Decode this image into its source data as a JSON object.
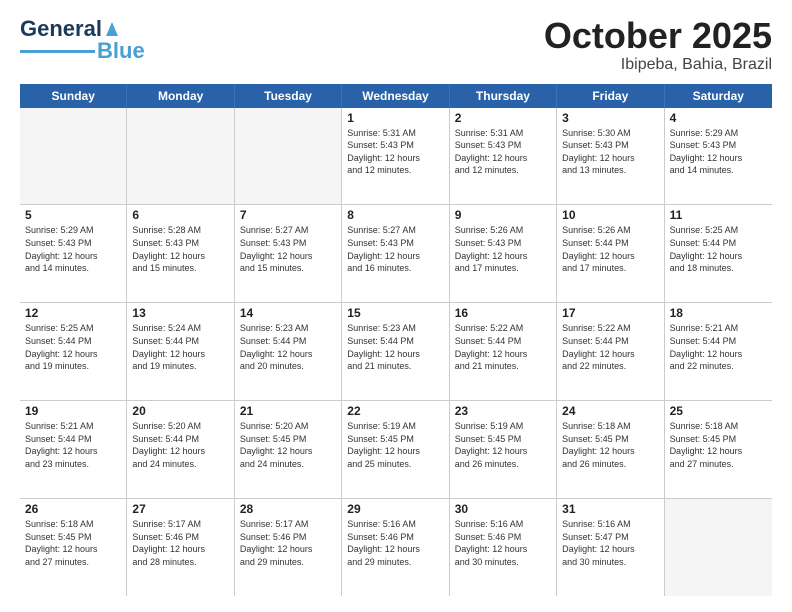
{
  "logo": {
    "text1": "General",
    "text2": "Blue"
  },
  "title": "October 2025",
  "location": "Ibipeba, Bahia, Brazil",
  "days": [
    "Sunday",
    "Monday",
    "Tuesday",
    "Wednesday",
    "Thursday",
    "Friday",
    "Saturday"
  ],
  "weeks": [
    [
      {
        "day": "",
        "info": ""
      },
      {
        "day": "",
        "info": ""
      },
      {
        "day": "",
        "info": ""
      },
      {
        "day": "1",
        "info": "Sunrise: 5:31 AM\nSunset: 5:43 PM\nDaylight: 12 hours\nand 12 minutes."
      },
      {
        "day": "2",
        "info": "Sunrise: 5:31 AM\nSunset: 5:43 PM\nDaylight: 12 hours\nand 12 minutes."
      },
      {
        "day": "3",
        "info": "Sunrise: 5:30 AM\nSunset: 5:43 PM\nDaylight: 12 hours\nand 13 minutes."
      },
      {
        "day": "4",
        "info": "Sunrise: 5:29 AM\nSunset: 5:43 PM\nDaylight: 12 hours\nand 14 minutes."
      }
    ],
    [
      {
        "day": "5",
        "info": "Sunrise: 5:29 AM\nSunset: 5:43 PM\nDaylight: 12 hours\nand 14 minutes."
      },
      {
        "day": "6",
        "info": "Sunrise: 5:28 AM\nSunset: 5:43 PM\nDaylight: 12 hours\nand 15 minutes."
      },
      {
        "day": "7",
        "info": "Sunrise: 5:27 AM\nSunset: 5:43 PM\nDaylight: 12 hours\nand 15 minutes."
      },
      {
        "day": "8",
        "info": "Sunrise: 5:27 AM\nSunset: 5:43 PM\nDaylight: 12 hours\nand 16 minutes."
      },
      {
        "day": "9",
        "info": "Sunrise: 5:26 AM\nSunset: 5:43 PM\nDaylight: 12 hours\nand 17 minutes."
      },
      {
        "day": "10",
        "info": "Sunrise: 5:26 AM\nSunset: 5:44 PM\nDaylight: 12 hours\nand 17 minutes."
      },
      {
        "day": "11",
        "info": "Sunrise: 5:25 AM\nSunset: 5:44 PM\nDaylight: 12 hours\nand 18 minutes."
      }
    ],
    [
      {
        "day": "12",
        "info": "Sunrise: 5:25 AM\nSunset: 5:44 PM\nDaylight: 12 hours\nand 19 minutes."
      },
      {
        "day": "13",
        "info": "Sunrise: 5:24 AM\nSunset: 5:44 PM\nDaylight: 12 hours\nand 19 minutes."
      },
      {
        "day": "14",
        "info": "Sunrise: 5:23 AM\nSunset: 5:44 PM\nDaylight: 12 hours\nand 20 minutes."
      },
      {
        "day": "15",
        "info": "Sunrise: 5:23 AM\nSunset: 5:44 PM\nDaylight: 12 hours\nand 21 minutes."
      },
      {
        "day": "16",
        "info": "Sunrise: 5:22 AM\nSunset: 5:44 PM\nDaylight: 12 hours\nand 21 minutes."
      },
      {
        "day": "17",
        "info": "Sunrise: 5:22 AM\nSunset: 5:44 PM\nDaylight: 12 hours\nand 22 minutes."
      },
      {
        "day": "18",
        "info": "Sunrise: 5:21 AM\nSunset: 5:44 PM\nDaylight: 12 hours\nand 22 minutes."
      }
    ],
    [
      {
        "day": "19",
        "info": "Sunrise: 5:21 AM\nSunset: 5:44 PM\nDaylight: 12 hours\nand 23 minutes."
      },
      {
        "day": "20",
        "info": "Sunrise: 5:20 AM\nSunset: 5:44 PM\nDaylight: 12 hours\nand 24 minutes."
      },
      {
        "day": "21",
        "info": "Sunrise: 5:20 AM\nSunset: 5:45 PM\nDaylight: 12 hours\nand 24 minutes."
      },
      {
        "day": "22",
        "info": "Sunrise: 5:19 AM\nSunset: 5:45 PM\nDaylight: 12 hours\nand 25 minutes."
      },
      {
        "day": "23",
        "info": "Sunrise: 5:19 AM\nSunset: 5:45 PM\nDaylight: 12 hours\nand 26 minutes."
      },
      {
        "day": "24",
        "info": "Sunrise: 5:18 AM\nSunset: 5:45 PM\nDaylight: 12 hours\nand 26 minutes."
      },
      {
        "day": "25",
        "info": "Sunrise: 5:18 AM\nSunset: 5:45 PM\nDaylight: 12 hours\nand 27 minutes."
      }
    ],
    [
      {
        "day": "26",
        "info": "Sunrise: 5:18 AM\nSunset: 5:45 PM\nDaylight: 12 hours\nand 27 minutes."
      },
      {
        "day": "27",
        "info": "Sunrise: 5:17 AM\nSunset: 5:46 PM\nDaylight: 12 hours\nand 28 minutes."
      },
      {
        "day": "28",
        "info": "Sunrise: 5:17 AM\nSunset: 5:46 PM\nDaylight: 12 hours\nand 29 minutes."
      },
      {
        "day": "29",
        "info": "Sunrise: 5:16 AM\nSunset: 5:46 PM\nDaylight: 12 hours\nand 29 minutes."
      },
      {
        "day": "30",
        "info": "Sunrise: 5:16 AM\nSunset: 5:46 PM\nDaylight: 12 hours\nand 30 minutes."
      },
      {
        "day": "31",
        "info": "Sunrise: 5:16 AM\nSunset: 5:47 PM\nDaylight: 12 hours\nand 30 minutes."
      },
      {
        "day": "",
        "info": ""
      }
    ]
  ]
}
